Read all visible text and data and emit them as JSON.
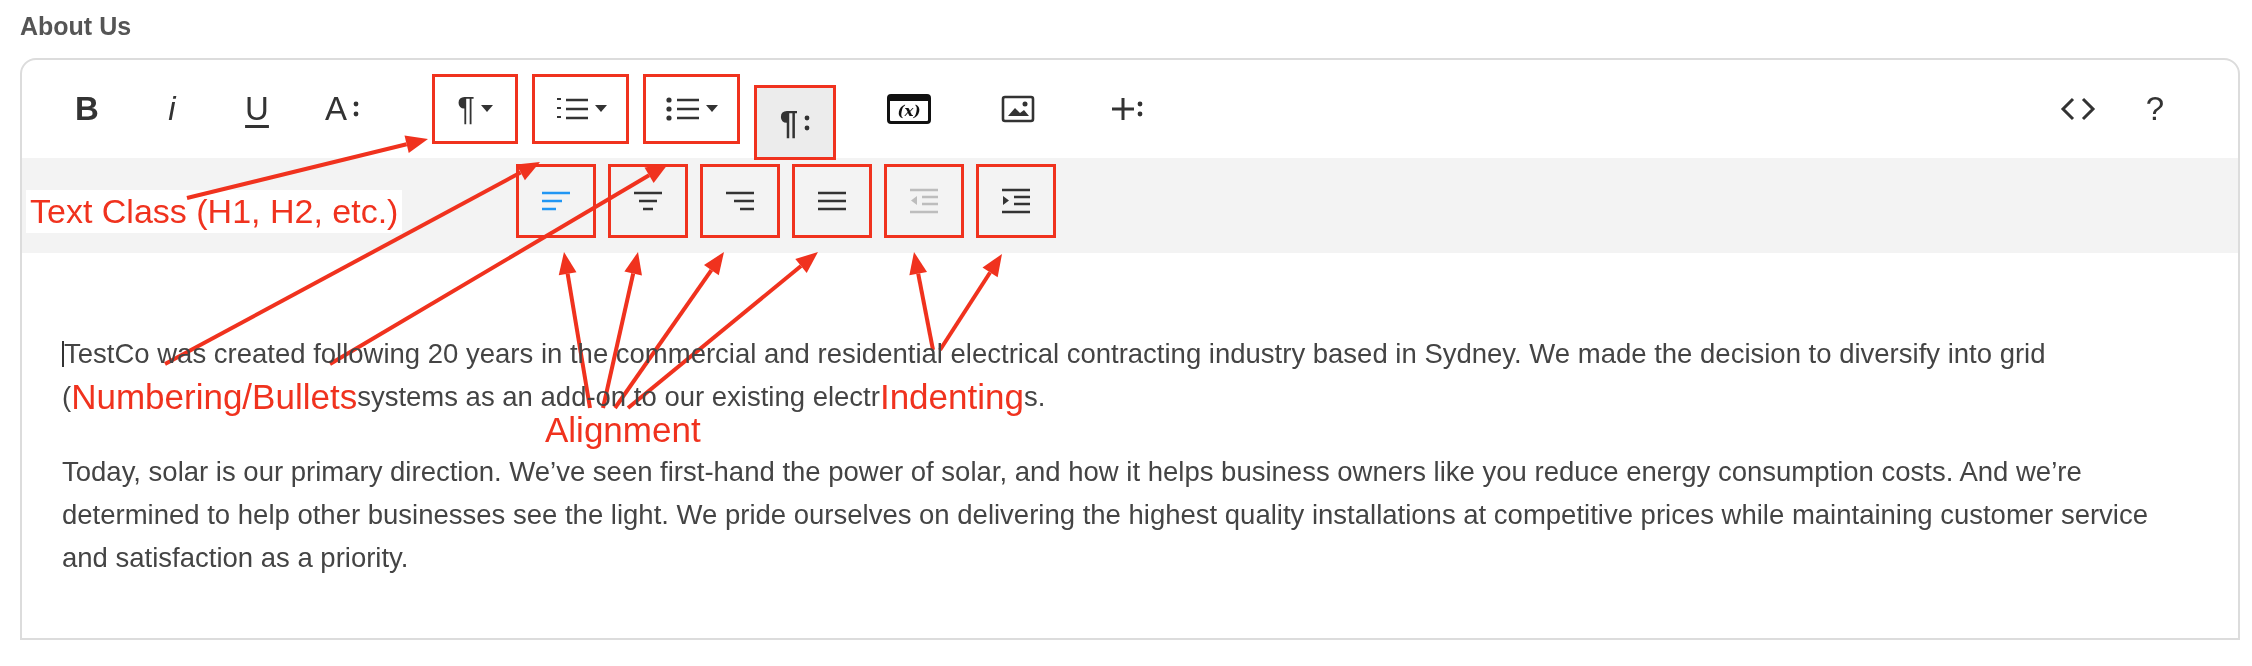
{
  "heading": "About Us",
  "toolbar": {
    "groups": [
      [
        {
          "kind": "bold",
          "label": "B",
          "annotated": false,
          "active": false
        },
        {
          "kind": "italic",
          "label": "i",
          "annotated": false,
          "active": false
        },
        {
          "kind": "underline",
          "label": "U",
          "annotated": false,
          "active": false
        },
        {
          "kind": "font-size",
          "label": "A",
          "annotated": false,
          "active": false
        }
      ],
      [
        {
          "kind": "paragraph-format",
          "label": "¶",
          "annotated": true,
          "active": false
        },
        {
          "kind": "ordered-list",
          "annotated": true,
          "active": false
        },
        {
          "kind": "unordered-list",
          "annotated": true,
          "active": false
        },
        {
          "kind": "paragraph-style",
          "label": "¶",
          "annotated": true,
          "active": true
        }
      ],
      [
        {
          "kind": "variable",
          "label": "(x)",
          "annotated": false,
          "active": false
        },
        {
          "kind": "image",
          "annotated": false,
          "active": false
        },
        {
          "kind": "more",
          "annotated": false,
          "active": false
        }
      ],
      [
        {
          "kind": "code",
          "annotated": false,
          "active": false
        },
        {
          "kind": "help",
          "label": "?",
          "annotated": false,
          "active": false
        }
      ]
    ]
  },
  "alignment_bar": [
    {
      "kind": "align-left",
      "selected": true,
      "disabled": false,
      "annotated": true
    },
    {
      "kind": "align-center",
      "selected": false,
      "disabled": false,
      "annotated": true
    },
    {
      "kind": "align-right",
      "selected": false,
      "disabled": false,
      "annotated": true
    },
    {
      "kind": "align-justify",
      "selected": false,
      "disabled": false,
      "annotated": true
    },
    {
      "kind": "outdent",
      "selected": false,
      "disabled": true,
      "annotated": true
    },
    {
      "kind": "indent",
      "selected": false,
      "disabled": false,
      "annotated": true
    }
  ],
  "content": {
    "paragraphs": [
      {
        "lines": [
          [
            {
              "kind": "caret"
            },
            {
              "kind": "text",
              "text": "TestCo was created following 20 years in the commercial and residential electrical contracting industry based in Sydney. We made the decision to diversify into grid"
            }
          ],
          [
            {
              "kind": "text",
              "text": "("
            },
            {
              "kind": "callout",
              "text": "Numbering/Bullets"
            },
            {
              "kind": "text",
              "text": "systems as an add-on to our existing electr"
            },
            {
              "kind": "callout",
              "text": "Indenting"
            },
            {
              "kind": "text",
              "text": "s."
            }
          ]
        ]
      },
      {
        "lines": [
          [
            {
              "kind": "text",
              "text": "Today, solar is our primary direction. We’ve seen first-hand the power of solar, and how it helps business owners like you reduce energy consumption costs. And we’re"
            }
          ],
          [
            {
              "kind": "text",
              "text": "determined to help other businesses see the light. We pride ourselves on delivering the highest quality installations at competitive prices while maintaining customer service"
            }
          ],
          [
            {
              "kind": "text",
              "text": "and satisfaction as a priority."
            }
          ]
        ]
      }
    ]
  },
  "callouts": [
    {
      "text": "Text Class (H1, H2, etc.)"
    },
    {
      "text": "Alignment"
    }
  ]
}
